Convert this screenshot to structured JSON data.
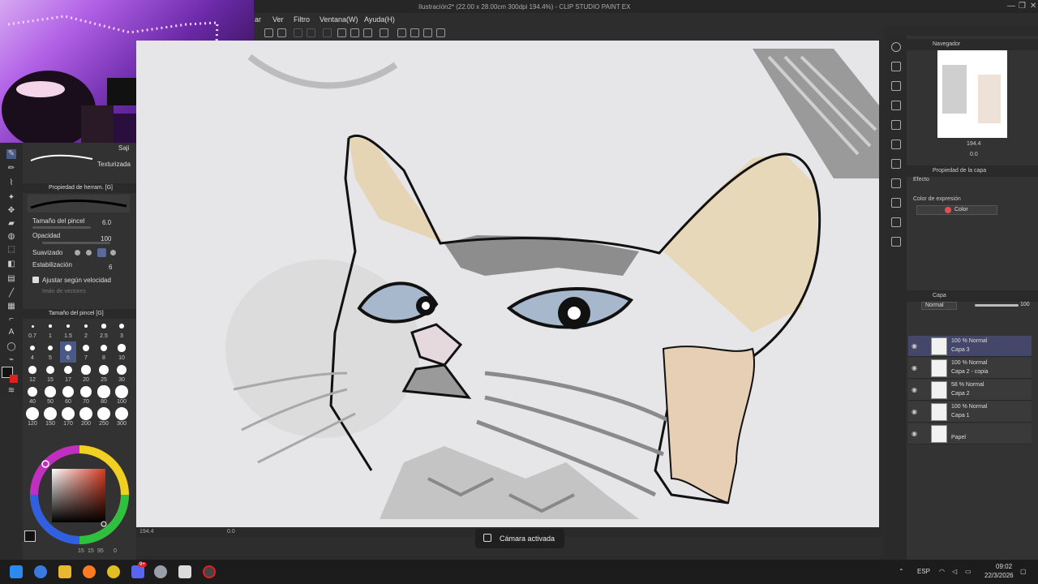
{
  "window": {
    "title": "Ilustración2* (22.00 x 28.00cm 300dpi 194.4%) - CLIP STUDIO PAINT EX",
    "controls": [
      "—",
      "❐",
      "✕"
    ]
  },
  "menu": [
    "ar",
    "Ver",
    "Filtro",
    "Ventana(W)",
    "Ayuda(H)"
  ],
  "left_panel": {
    "subtool_label": "Saji",
    "brush_name": "Texturizada",
    "tool_property_header": "Propiedad de herram. [G]",
    "brush_size_label": "Tamaño del pincel",
    "brush_size_value": "6.0",
    "opacity_label": "Opacidad",
    "opacity_value": "100",
    "smoothing_label": "Suavizado",
    "stabilization_label": "Estabilización",
    "stabilization_value": "6",
    "velocity_label": "Ajustar según velocidad",
    "vector_label": "Imán de vectores",
    "brush_size_panel_header": "Tamaño del pincel [G]",
    "brush_sizes": [
      "0.7",
      "1",
      "1.5",
      "2",
      "2.5",
      "3",
      "4",
      "5",
      "6",
      "7",
      "8",
      "10",
      "12",
      "15",
      "17",
      "20",
      "25",
      "30",
      "40",
      "50",
      "60",
      "70",
      "80",
      "100",
      "120",
      "150",
      "170",
      "200",
      "250",
      "300"
    ],
    "selected_size": "6",
    "color_values": [
      "15",
      "15",
      "95",
      "0"
    ]
  },
  "canvas": {
    "zoom": "194.4",
    "angle": "0.0"
  },
  "toast": {
    "text": "Cámara activada"
  },
  "navigator": {
    "header": "Navegador",
    "zoom": "194.4",
    "angle": "0.0"
  },
  "layer_property": {
    "header": "Propiedad de la capa",
    "effect_label": "Efecto",
    "expression_label": "Color de expresión",
    "expression_value": "Color"
  },
  "layers_panel": {
    "header": "Capa",
    "blend_mode": "Normal",
    "opacity": "100",
    "layers": [
      {
        "pct": "100 % Normal",
        "name": "Capa 3",
        "selected": true
      },
      {
        "pct": "100 % Normal",
        "name": "Capa 2 - copia",
        "selected": false
      },
      {
        "pct": "58 % Normal",
        "name": "Capa 2",
        "selected": false
      },
      {
        "pct": "100 % Normal",
        "name": "Capa 1",
        "selected": false
      },
      {
        "pct": "",
        "name": "Papel",
        "selected": false
      }
    ]
  },
  "taskbar": {
    "language": "ESP",
    "time": "09:02",
    "date": "22/3/2026",
    "discord_badge": "9+"
  }
}
